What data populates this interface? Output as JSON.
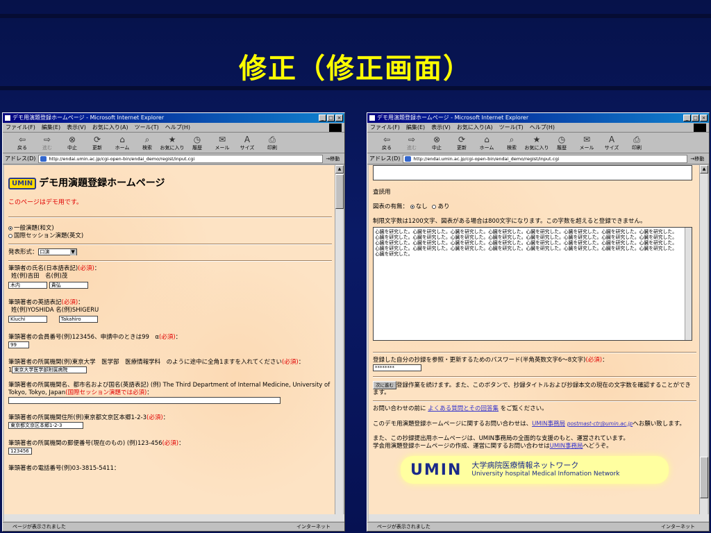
{
  "slide": {
    "title": "修正（修正画面）"
  },
  "browser": {
    "window_title": "デモ用演題登録ホームページ - Microsoft Internet Explorer",
    "menu": [
      "ファイル(F)",
      "編集(E)",
      "表示(V)",
      "お気に入り(A)",
      "ツール(T)",
      "ヘルプ(H)"
    ],
    "toolbar": [
      "戻る",
      "進む",
      "中止",
      "更新",
      "ホーム",
      "検索",
      "お気に入り",
      "履歴",
      "メール",
      "サイズ",
      "印刷"
    ],
    "address_label": "アドレス(D)",
    "address_url": "http://endai.umin.ac.jp/cgi-open-bin/endai_demo/regist/input.cgi",
    "go_label": "移動",
    "status_text": "ページが表示されました",
    "zone_text": "インターネット"
  },
  "left": {
    "logo": "UMIN",
    "page_heading": "デモ用演題登録ホームページ",
    "demo_notice": "このページはデモ用です。",
    "radio_general": "一般演題(和文)",
    "radio_intl": "国際セッション演題(英文)",
    "format_label": "発表形式：",
    "format_value": "口演",
    "name_jp_label": "筆頭者の氏名(日本語表記)",
    "required": "(必須)",
    "colon": "：",
    "name_jp_example": "姓(例)吉田　名(例)茂",
    "name_jp_last": "木内",
    "name_jp_first": "貴弘",
    "name_en_label": "筆頭著者の英語表記",
    "name_en_example": "姓(例)YOSHIDA 名(例)SHIGERU",
    "name_en_last": "Kiuchi",
    "name_en_first": "Takahiro",
    "member_label": "筆頭著者の会員番号(例)123456、申請中のときは99　α",
    "member_value": "99",
    "affil_label": "筆頭著者の所属機関(例)東京大学　医学部　医療情報学科　のように途中に全角1ますを入れてください",
    "affil_prefix": "1",
    "affil_value": "東京大学医学部附属病院",
    "affil_en_label": "筆頭著者の所属機関名、都市名および国名(英語表記) (例) The Third Department of Internal Medicine, University of Tokyo, Tokyo, Japan",
    "affil_en_required": "(国際セッション演題では必須)",
    "address_label": "筆頭著者の所属機関住所(例)東京都文京区本郷1-2-3",
    "address_value": "東京都文京区本郷1-2-3",
    "postal_label": "筆頭著者の所属機関の郵便番号(現在のもの) (例)123-456",
    "postal_value": "123456",
    "phone_label": "筆頭著者の電話番号(例)03-3815-5411："
  },
  "right": {
    "section_label": "査読用",
    "figure_label": "図表の有無：",
    "figure_none": "なし",
    "figure_yes": "あり",
    "limit_text": "制限文字数は1200文字、図表がある場合は800文字になります。この字数を超えると登録できません。",
    "abstract_text": "心臓を研究した。心臓を研究した。心臓を研究した。心臓を研究した。心臓を研究した。心臓を研究した。心臓を研究した。心臓を研究した。心臓を研究した。心臓を研究した。心臓を研究した。心臓を研究した。心臓を研究した。心臓を研究した。心臓を研究した。心臓を研究した。心臓を研究した。心臓を研究した。心臓を研究した。心臓を研究した。心臓を研究した。心臓を研究した。心臓を研究した。心臓を研究した。心臓を研究した。心臓を研究した。心臓を研究した。心臓を研究した。心臓を研究した。心臓を研究した。心臓を研究した。心臓を研究した。心臓を研究した。",
    "password_label": "登録した自分の抄録を参照・更新するためのパスワード(半角英数文字6〜8文字)",
    "required": "(必須)",
    "colon": "：",
    "password_value": "********",
    "next_button": "次に進む",
    "next_desc": "登録作業を続けます。また、このボタンで、抄録タイトルおよび抄録本文の現在の文字数を確認することができます。",
    "faq_prefix": "お問い合わせの前に",
    "faq_link": "よくある質問とその回答集",
    "faq_suffix": "をご覧ください。",
    "contact_prefix": "このデモ用演題登録ホームページに関するお問い合わせは、",
    "contact_link": "UMIN事務局",
    "contact_email": "postmast-ctr@umin.ac.jp",
    "contact_suffix": "へお願い致します。",
    "support_text": "また、この抄録提出用ホームページは、UMIN事務局の全面的な支援のもと、運営されています。",
    "support_text2": "学会用演題登録ホームページの作成、運営に関するお問い合わせは",
    "support_link": "UMIN事務局",
    "support_suffix": "へどうぞ。",
    "banner_logo": "UMIN",
    "banner_jp": "大学病院医療情報ネットワーク",
    "banner_en": "University hospital Medical Infomation Network"
  }
}
